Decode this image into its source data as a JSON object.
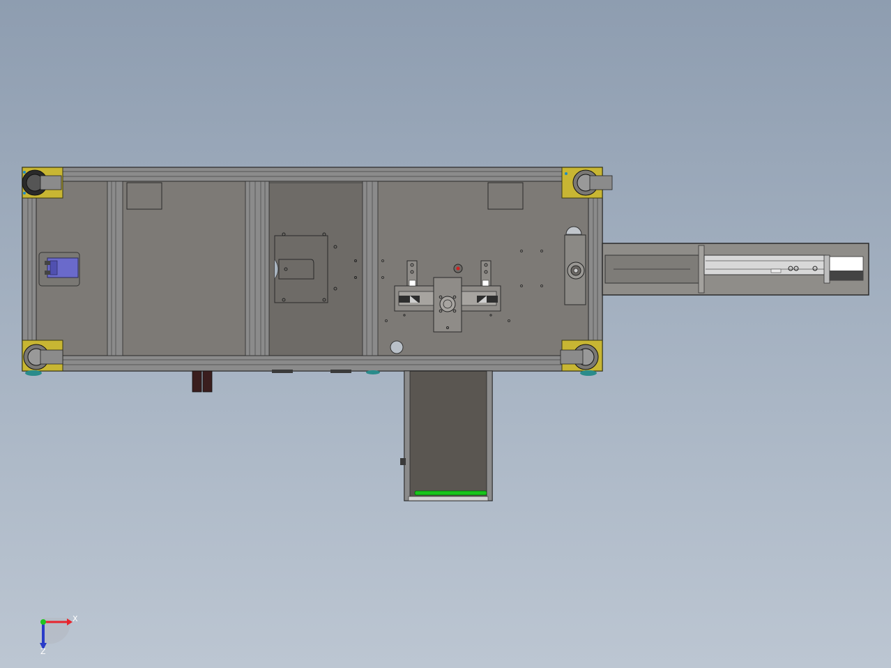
{
  "viewport": {
    "background_top": "#8e9db0",
    "background_bottom": "#bcc6d2",
    "model": {
      "frame_color": "#6f6f6f",
      "plate_color": "#7d7a76",
      "drawer_color": "#5a5651",
      "corner_bracket_color": "#c8b633",
      "cylinder_color": "#6a6acb",
      "indicator_color": "#18c51a"
    },
    "triad": {
      "x_label": "X",
      "z_label": "Z",
      "x_color": "#e8242c",
      "y_color": "#1fc51f",
      "z_color": "#2a3cc8"
    }
  }
}
